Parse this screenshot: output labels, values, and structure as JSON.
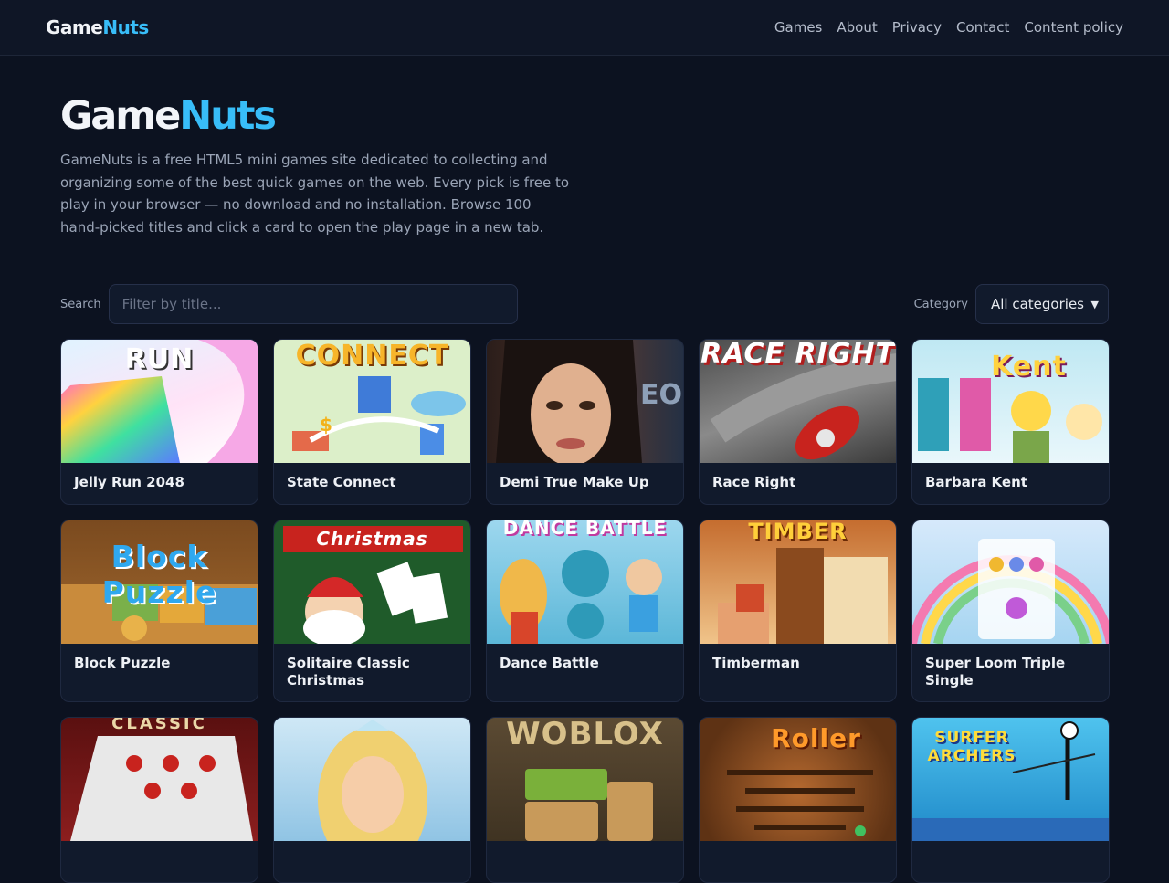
{
  "header": {
    "brand_part1": "Game",
    "brand_part2": "Nuts",
    "nav": [
      {
        "label": "Games"
      },
      {
        "label": "About"
      },
      {
        "label": "Privacy"
      },
      {
        "label": "Contact"
      },
      {
        "label": "Content policy"
      }
    ]
  },
  "hero": {
    "title_part1": "Game",
    "title_part2": "Nuts",
    "description": "GameNuts is a free HTML5 mini games site dedicated to collecting and organizing some of the best quick games on the web. Every pick is free to play in your browser — no download and no installation. Browse 100 hand-picked titles and click a card to open the play page in a new tab."
  },
  "filters": {
    "search_label": "Search",
    "search_placeholder": "Filter by title...",
    "search_value": "",
    "category_label": "Category",
    "category_selected": "All categories"
  },
  "colors": {
    "accent": "#38bdf8",
    "background": "#0c1220",
    "card": "#111a2c"
  },
  "games": [
    {
      "title": "Jelly Run 2048",
      "thumb_text": "RUN"
    },
    {
      "title": "State Connect",
      "thumb_text": "CONNECT"
    },
    {
      "title": "Demi True Make Up",
      "thumb_text": ""
    },
    {
      "title": "Race Right",
      "thumb_text": "RACE RIGHT"
    },
    {
      "title": "Barbara Kent",
      "thumb_text": "Kent"
    },
    {
      "title": "Block Puzzle",
      "thumb_text": "Block Puzzle"
    },
    {
      "title": "Solitaire Classic Christmas",
      "thumb_text": "Christmas"
    },
    {
      "title": "Dance Battle",
      "thumb_text": "DANCE BATTLE"
    },
    {
      "title": "Timberman",
      "thumb_text": "TIMBER"
    },
    {
      "title": "Super Loom Triple Single",
      "thumb_text": ""
    },
    {
      "title": "",
      "thumb_text": "CLASSIC"
    },
    {
      "title": "",
      "thumb_text": ""
    },
    {
      "title": "",
      "thumb_text": "WOBLOX"
    },
    {
      "title": "",
      "thumb_text": "Roller"
    },
    {
      "title": "",
      "thumb_text": "SURFER ARCHERS"
    }
  ]
}
